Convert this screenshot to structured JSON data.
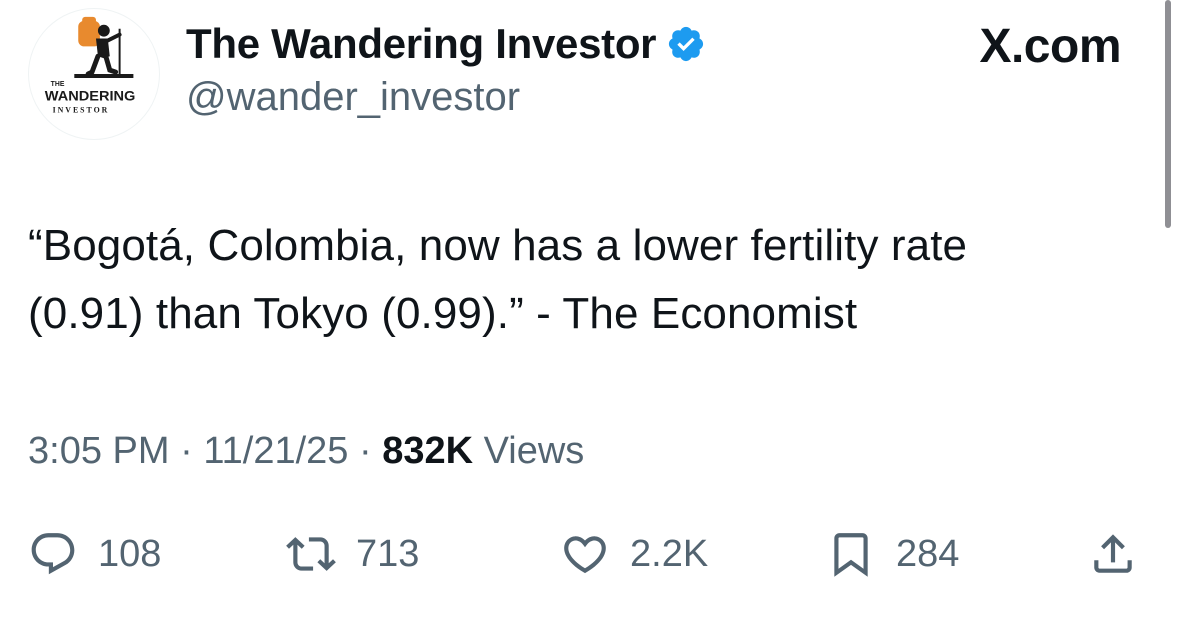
{
  "author": {
    "display_name": "The Wandering Investor",
    "handle": "@wander_investor",
    "verified": true,
    "avatar_text_small": "THE",
    "avatar_text_main": "WANDERING",
    "avatar_text_sub": "INVESTOR",
    "avatar_icon": "hiker-logo"
  },
  "brand": "X.com",
  "tweet": {
    "line1": "“Bogotá, Colombia, now has a lower fertility rate",
    "line2": "(0.91) than Tokyo (0.99).” - The Economist"
  },
  "meta": {
    "time": "3:05 PM",
    "date": "11/21/25",
    "separator": " · ",
    "views_count": "832K",
    "views_label": "Views"
  },
  "actions": {
    "replies": "108",
    "reposts": "713",
    "likes": "2.2K",
    "bookmarks": "284"
  },
  "colors": {
    "primary_text": "#0f1419",
    "secondary_text": "#536471",
    "verified_blue": "#1d9bf0",
    "background": "#ffffff"
  }
}
